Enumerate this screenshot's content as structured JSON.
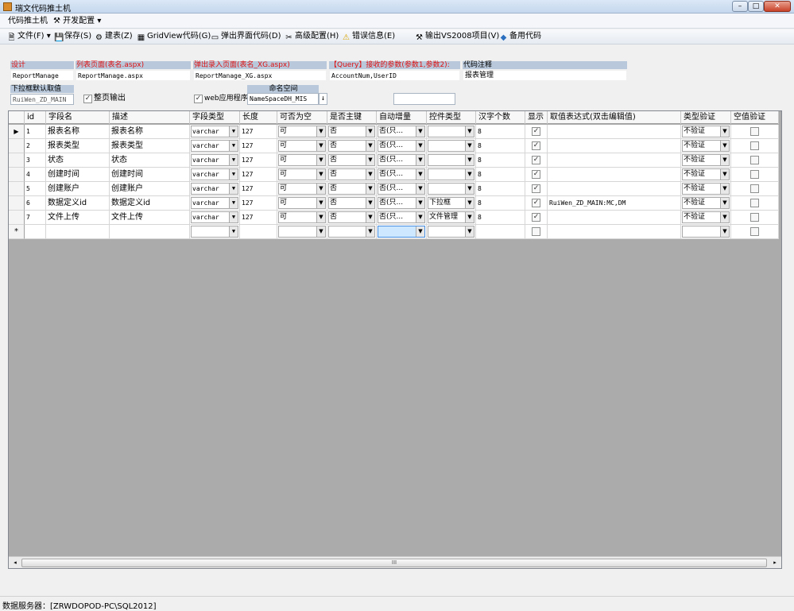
{
  "window": {
    "title": "瑞文代码推土机",
    "minimize": "–",
    "maximize": "□",
    "close": "✕"
  },
  "menubar": {
    "items": [
      "代码推土机",
      "开发配置"
    ]
  },
  "toolbar": {
    "items": [
      {
        "label": "文件(F)",
        "icon": "file-icon"
      },
      {
        "label": "保存(S)",
        "icon": "save-icon"
      },
      {
        "label": "建表(Z)",
        "icon": "build-table-icon"
      },
      {
        "label": "GridView代码(G)",
        "icon": "grid-icon"
      },
      {
        "label": "弹出界面代码(D)",
        "icon": "popup-icon"
      },
      {
        "label": "高级配置(H)",
        "icon": "settings-icon"
      },
      {
        "label": "错误信息(E)",
        "icon": "warning-icon"
      },
      {
        "label": "输出VS2008项目(V)",
        "icon": "export-icon"
      },
      {
        "label": "备用代码",
        "icon": "code-icon"
      }
    ]
  },
  "form": {
    "design_label": "设计",
    "design_value": "ReportManage",
    "list_page_label": "列表页面(表名.aspx)",
    "list_page_value": "ReportManage.aspx",
    "popup_page_label": "弹出录入页面(表名_XG.aspx)",
    "popup_page_value": "ReportManage_XG.aspx",
    "query_label": "【Query】接收的参数(参数1,参数2):",
    "query_value": "AccountNum,UserID",
    "comment_label": "代码注释",
    "comment_value": "报表管理",
    "dropdown_default_label": "下拉框默认取值",
    "dropdown_default_value": "RuiWen_ZD_MAIN",
    "full_page_label": "整页输出",
    "web_app_label": "web应用程序",
    "namespace_label": "命名空间",
    "namespace_value": "NameSpaceDH_MIS",
    "extra_value": ""
  },
  "grid": {
    "headers": [
      "id",
      "字段名",
      "描述",
      "字段类型",
      "长度",
      "可否为空",
      "是否主键",
      "自动增量",
      "控件类型",
      "汉字个数",
      "显示",
      "取值表达式(双击编辑值)",
      "类型验证",
      "空值验证"
    ],
    "rows": [
      {
        "id": "1",
        "name": "报表名称",
        "desc": "报表名称",
        "type": "varchar",
        "len": "127",
        "nullable": "可",
        "pk": "否",
        "auto": "否(只...",
        "ctrl": "",
        "chars": "8",
        "show": true,
        "expr": "",
        "typecheck": "不验证",
        "nullcheck": false
      },
      {
        "id": "2",
        "name": "报表类型",
        "desc": "报表类型",
        "type": "varchar",
        "len": "127",
        "nullable": "可",
        "pk": "否",
        "auto": "否(只...",
        "ctrl": "",
        "chars": "8",
        "show": true,
        "expr": "",
        "typecheck": "不验证",
        "nullcheck": false
      },
      {
        "id": "3",
        "name": "状态",
        "desc": "状态",
        "type": "varchar",
        "len": "127",
        "nullable": "可",
        "pk": "否",
        "auto": "否(只...",
        "ctrl": "",
        "chars": "8",
        "show": true,
        "expr": "",
        "typecheck": "不验证",
        "nullcheck": false
      },
      {
        "id": "4",
        "name": "创建时间",
        "desc": "创建时间",
        "type": "varchar",
        "len": "127",
        "nullable": "可",
        "pk": "否",
        "auto": "否(只...",
        "ctrl": "",
        "chars": "8",
        "show": true,
        "expr": "",
        "typecheck": "不验证",
        "nullcheck": false
      },
      {
        "id": "5",
        "name": "创建账户",
        "desc": "创建账户",
        "type": "varchar",
        "len": "127",
        "nullable": "可",
        "pk": "否",
        "auto": "否(只...",
        "ctrl": "",
        "chars": "8",
        "show": true,
        "expr": "",
        "typecheck": "不验证",
        "nullcheck": false
      },
      {
        "id": "6",
        "name": "数据定义id",
        "desc": "数据定义id",
        "type": "varchar",
        "len": "127",
        "nullable": "可",
        "pk": "否",
        "auto": "否(只...",
        "ctrl": "下拉框",
        "chars": "8",
        "show": true,
        "expr": "RuiWen_ZD_MAIN:MC,DM",
        "typecheck": "不验证",
        "nullcheck": false
      },
      {
        "id": "7",
        "name": "文件上传",
        "desc": "文件上传",
        "type": "varchar",
        "len": "127",
        "nullable": "可",
        "pk": "否",
        "auto": "否(只...",
        "ctrl": "文件管理",
        "chars": "8",
        "show": true,
        "expr": "",
        "typecheck": "不验证",
        "nullcheck": false
      }
    ],
    "new_row_marker": "*",
    "current_row_marker": "▶",
    "scroll_grip": "III"
  },
  "status": {
    "text": "数据服务器：[ZRWDOPOD-PC\\SQL2012]"
  },
  "colors": {
    "label_bg": "#b9c9db",
    "label_red": "#d11111",
    "grid_bg": "#ababab",
    "title_bg": "#c5d8ee"
  }
}
